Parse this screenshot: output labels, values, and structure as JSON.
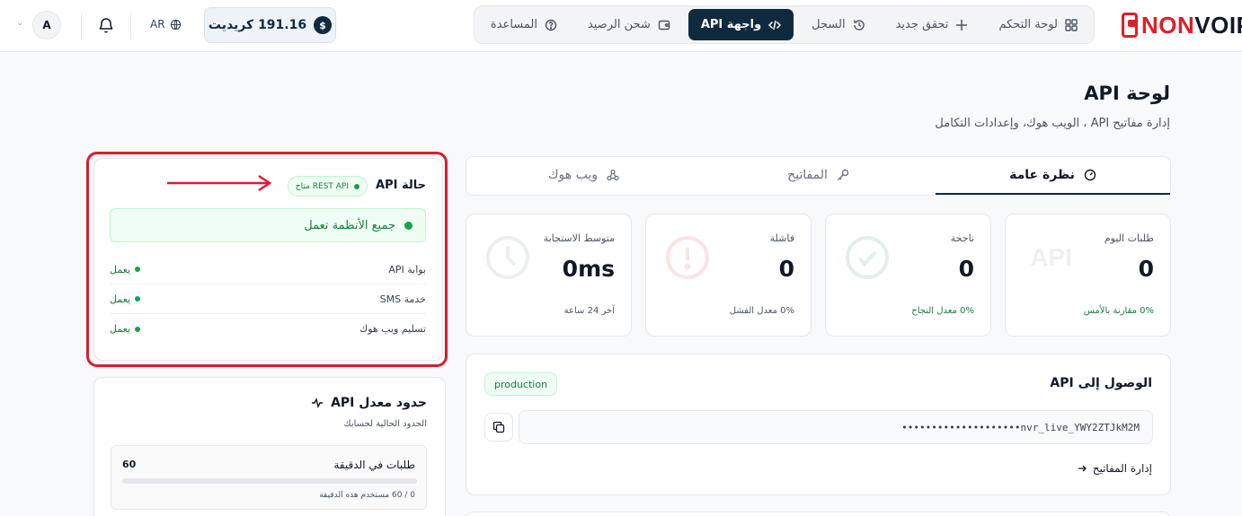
{
  "header": {
    "logo_text_red": "NON",
    "logo_text_dark": "VOIP",
    "nav": [
      {
        "label": "لوحة التحكم",
        "icon": "grid-icon"
      },
      {
        "label": "تحقق جديد",
        "icon": "plus-icon"
      },
      {
        "label": "السجل",
        "icon": "history-icon"
      },
      {
        "label": "واجهة API",
        "icon": "code-icon",
        "active": true
      },
      {
        "label": "شحن الرصيد",
        "icon": "wallet-icon"
      },
      {
        "label": "المساعدة",
        "icon": "help-icon"
      }
    ],
    "credit_symbol": "$",
    "credit_label": "191.16 كريديت",
    "lang": "AR",
    "avatar_initial": "A"
  },
  "page": {
    "title": "لوحة API",
    "subtitle": "إدارة مفاتيح API ، الويب هوك، وإعدادات التكامل"
  },
  "tabs": [
    {
      "label": "نظرة عامة",
      "icon": "gauge-icon",
      "active": true
    },
    {
      "label": "المفاتيح",
      "icon": "key-icon"
    },
    {
      "label": "ويب هوك",
      "icon": "webhook-icon"
    }
  ],
  "stats": [
    {
      "label": "طلبات اليوم",
      "value": "0",
      "foot": "0% مقارنة بالأمس",
      "deco": "API"
    },
    {
      "label": "ناجحة",
      "value": "0",
      "foot": "0% معدل النجاح"
    },
    {
      "label": "فاشلة",
      "value": "0",
      "foot": "0% معدل الفشل"
    },
    {
      "label": "متوسط الاستجابة",
      "value": "0ms",
      "foot": "آخر 24 ساعة"
    }
  ],
  "access": {
    "title": "الوصول إلى API",
    "env": "production",
    "key": "••••••••••••••••••••nvr_live_YWY2ZTJkM2M",
    "manage_label": "إدارة المفاتيح"
  },
  "status": {
    "title": "حالة API",
    "badge": "REST API متاح",
    "all_ok": "جميع الأنظمة تعمل",
    "services": [
      {
        "name": "بوابة API",
        "state": "يعمل"
      },
      {
        "name": "خدمة SMS",
        "state": "يعمل"
      },
      {
        "name": "تسليم ويب هوك",
        "state": "يعمل"
      }
    ]
  },
  "rate": {
    "title": "حدود معدل API",
    "subtitle": "الحدود الحالية لحسابك",
    "label": "طلبات في الدقيقة",
    "limit": "60",
    "usage": "0 / 60 مستخدم هذه الدقيقة",
    "used_fraction": 0
  },
  "colors": {
    "brand": "#0f2a3f",
    "logo_red": "#e11d2a",
    "success": "#15803d",
    "highlight": "#dc1c2c"
  }
}
